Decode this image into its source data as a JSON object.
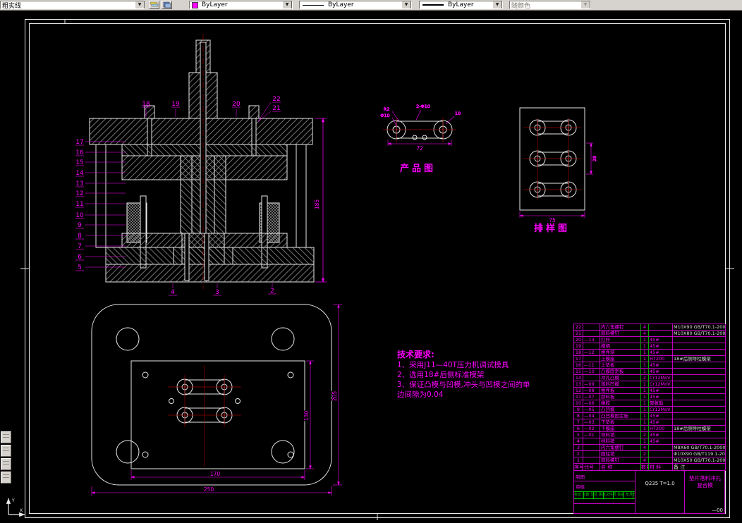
{
  "toolbar": {
    "layer_combo": "粗实线",
    "color_value": "ByLayer",
    "linetype_value": "ByLayer",
    "lineweight_value": "ByLayer",
    "plotstyle_value": "随颜色",
    "accent_color": "#ff00ff"
  },
  "views": {
    "section": {
      "callouts_left": [
        "17",
        "16",
        "15",
        "14",
        "13",
        "12",
        "11",
        "10",
        "9",
        "8",
        "7",
        "6",
        "5"
      ],
      "callouts_top": [
        "18",
        "19",
        "20",
        "21",
        "22"
      ],
      "callouts_bottom": [
        "4",
        "3",
        "2"
      ],
      "dim_height": "185"
    },
    "product": {
      "label": "产品图",
      "dim_width": "72",
      "dim_r": "R2",
      "dim_hole": "Φ10",
      "dim_holes": "2-Φ10",
      "dim_right": "10"
    },
    "layout": {
      "label": "排样图",
      "dim_width": "75",
      "dim_pitch": "29"
    },
    "plan": {
      "dim_outer_w": "250",
      "dim_inner_w": "170",
      "dim_outer_h": "205",
      "dim_inner_h": "130"
    }
  },
  "tech_requirements": {
    "title": "技术要求:",
    "line1": "1、采用J11—40T压力机调试模具",
    "line2": "2、选用18#后侧标准模架",
    "line3": "3、保证凸模与凹模,冲头与凹模之间的单",
    "line4": "边间隙为0.04"
  },
  "bom": {
    "headers": [
      "序号",
      "代号",
      "名  称",
      "数量",
      "材  料",
      "备  注"
    ],
    "rows": [
      [
        "22",
        "",
        "内六角螺钉",
        "4",
        "",
        "M10X90 GB/T70.1-2000"
      ],
      [
        "21",
        "",
        "卸料螺钉",
        "4",
        "",
        "M10X80 GB/T70.1-2000"
      ],
      [
        "20",
        "—13",
        "打杆",
        "1",
        "45#",
        ""
      ],
      [
        "19",
        "",
        "模柄",
        "1",
        "45#",
        ""
      ],
      [
        "18",
        "—12",
        "推件块",
        "1",
        "45#",
        ""
      ],
      [
        "17",
        "",
        "上模座",
        "1",
        "HT200",
        "18#后侧导柱模架"
      ],
      [
        "16",
        "—11",
        "上垫板",
        "1",
        "45#",
        ""
      ],
      [
        "15",
        "—10",
        "凸模固定板",
        "1",
        "45#",
        ""
      ],
      [
        "14",
        "",
        "冲孔凸模",
        "2",
        "Cr12MoV",
        ""
      ],
      [
        "13",
        "—09",
        "落料凹模",
        "1",
        "Cr12MoV",
        ""
      ],
      [
        "12",
        "—08",
        "推件板",
        "1",
        "45#",
        ""
      ],
      [
        "11",
        "—07",
        "卸料板",
        "1",
        "45#",
        ""
      ],
      [
        "10",
        "—06",
        "橡胶",
        "1",
        "聚氨酯",
        ""
      ],
      [
        "9",
        "—05",
        "凸凹模",
        "1",
        "Cr12MoV",
        ""
      ],
      [
        "8",
        "—04",
        "凸凹模固定板",
        "1",
        "45#",
        ""
      ],
      [
        "7",
        "—03",
        "下垫板",
        "1",
        "45#",
        ""
      ],
      [
        "6",
        "—02",
        "下模座",
        "1",
        "HT200",
        "18#后侧导柱模架"
      ],
      [
        "5",
        "—01",
        "导料销",
        "2",
        "45#",
        ""
      ],
      [
        "4",
        "",
        "挡料销",
        "1",
        "45#",
        ""
      ],
      [
        "3",
        "",
        "内六角螺钉",
        "4",
        "",
        "M8X60 GB/T70.1-2000"
      ],
      [
        "2",
        "",
        "圆柱销",
        "2",
        "",
        "Φ10X90 GB/T119.1-2000"
      ],
      [
        "1",
        "",
        "卸料螺钉",
        "4",
        "",
        "M10X50 GB/T70.1-2000"
      ]
    ]
  },
  "title_block": {
    "material_spec": "Q235  T=1.0",
    "drawing_no": "—00",
    "title_line1": "垫片落料冲孔",
    "title_line2": "复合模",
    "label_draw": "制图",
    "label_check": "审核",
    "revision_row": "标记 处数 分区 更改文件号 签名 年月日"
  }
}
